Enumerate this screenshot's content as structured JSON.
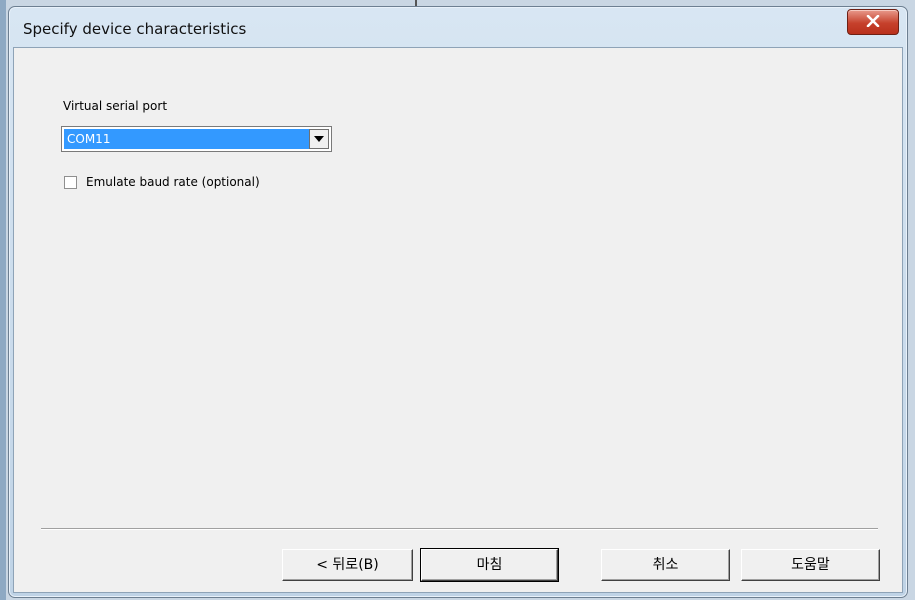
{
  "window": {
    "title": "Specify device characteristics"
  },
  "form": {
    "port_label": "Virtual serial port",
    "port_value": "COM11",
    "baud_checkbox_label": "Emulate baud rate (optional)",
    "baud_checked": false
  },
  "buttons": {
    "back": "< 뒤로(B)",
    "finish": "마침",
    "cancel": "취소",
    "help": "도움말"
  }
}
